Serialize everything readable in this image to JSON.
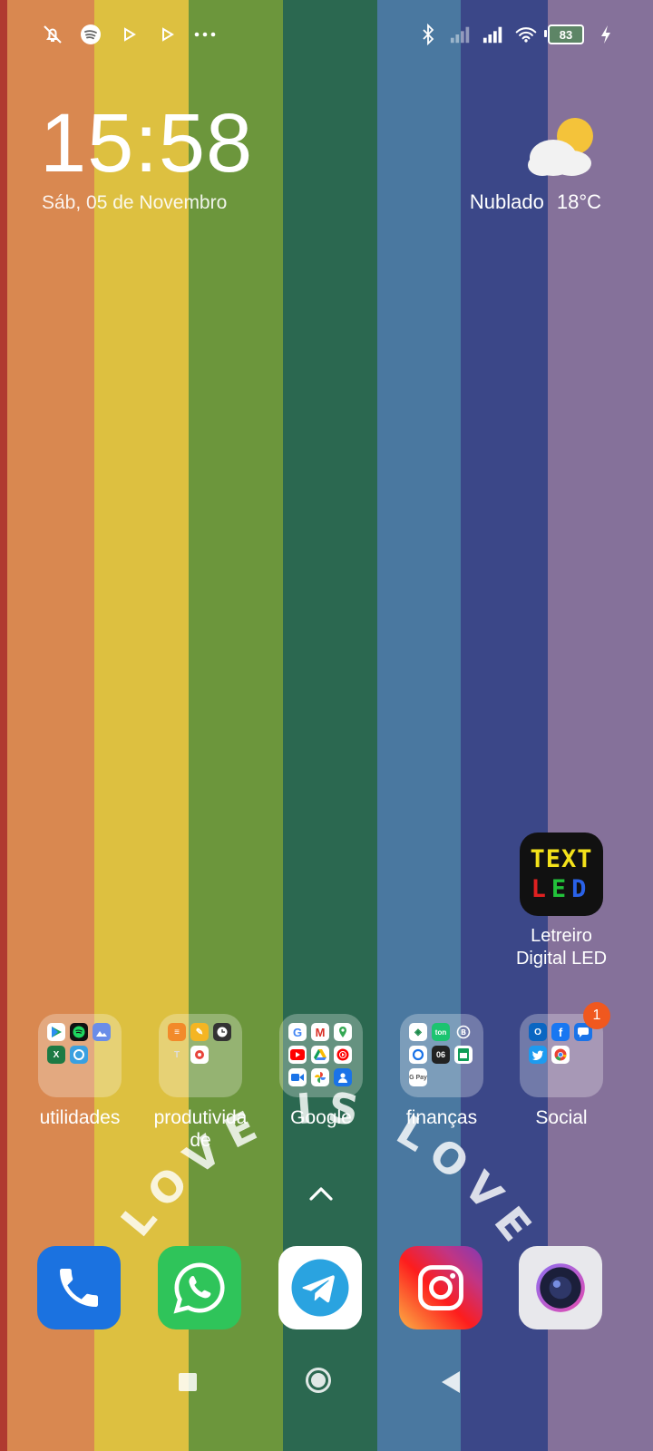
{
  "wallpaper": {
    "stripe_colors": [
      "#b03a30",
      "#d98850",
      "#ddc040",
      "#6c963c",
      "#2b6850",
      "#4a78a0",
      "#3b4788",
      "#85719a"
    ]
  },
  "status_bar": {
    "left_icons": [
      "alarm-off-icon",
      "spotify-icon",
      "play-icon",
      "play-icon",
      "more-icon"
    ],
    "right_icons": [
      "bluetooth-icon",
      "signal-weak-icon",
      "signal-full-icon",
      "wifi-icon",
      "battery-icon",
      "charging-icon"
    ],
    "battery_level": "83"
  },
  "clock_widget": {
    "time": "15:58",
    "date": "Sáb, 05 de Novembro"
  },
  "weather_widget": {
    "condition": "Nublado",
    "temperature": "18°C",
    "icon": "partly-cloudy-icon"
  },
  "led_app": {
    "icon_top": "TEXT",
    "icon_bottom": "LED",
    "label_line1": "Letreiro",
    "label_line2": "Digital LED"
  },
  "folders": [
    {
      "label": "utilidades",
      "apps": [
        "play-store-icon",
        "spotify-icon",
        "gallery-icon",
        "excel-icon",
        "scanner-icon"
      ]
    },
    {
      "label": "produtivida de",
      "apps": [
        "notes-icon",
        "pencil-icon",
        "clock-icon",
        "tool-icon",
        "recorder-icon"
      ]
    },
    {
      "label": "Google",
      "apps": [
        "google-icon",
        "gmail-icon",
        "maps-icon",
        "youtube-icon",
        "drive-icon",
        "youtube-music-icon",
        "meet-icon",
        "photos-icon",
        "contacts-icon"
      ]
    },
    {
      "label": "finanças",
      "apps": [
        "bank-icon",
        "ton-icon",
        "whatsapp-business-icon",
        "sync-icon",
        "app-06-icon",
        "sheets-icon",
        "gpay-icon"
      ]
    },
    {
      "label": "Social",
      "apps": [
        "outlook-icon",
        "facebook-icon",
        "messages-icon",
        "twitter-icon",
        "chrome-icon"
      ],
      "badge": "1"
    }
  ],
  "wallpaper_text": "LOVE IS LOVE",
  "dock": [
    "phone-icon",
    "whatsapp-icon",
    "telegram-icon",
    "instagram-icon",
    "camera-icon"
  ],
  "nav_bar": [
    "recents-button",
    "home-button",
    "back-button"
  ]
}
